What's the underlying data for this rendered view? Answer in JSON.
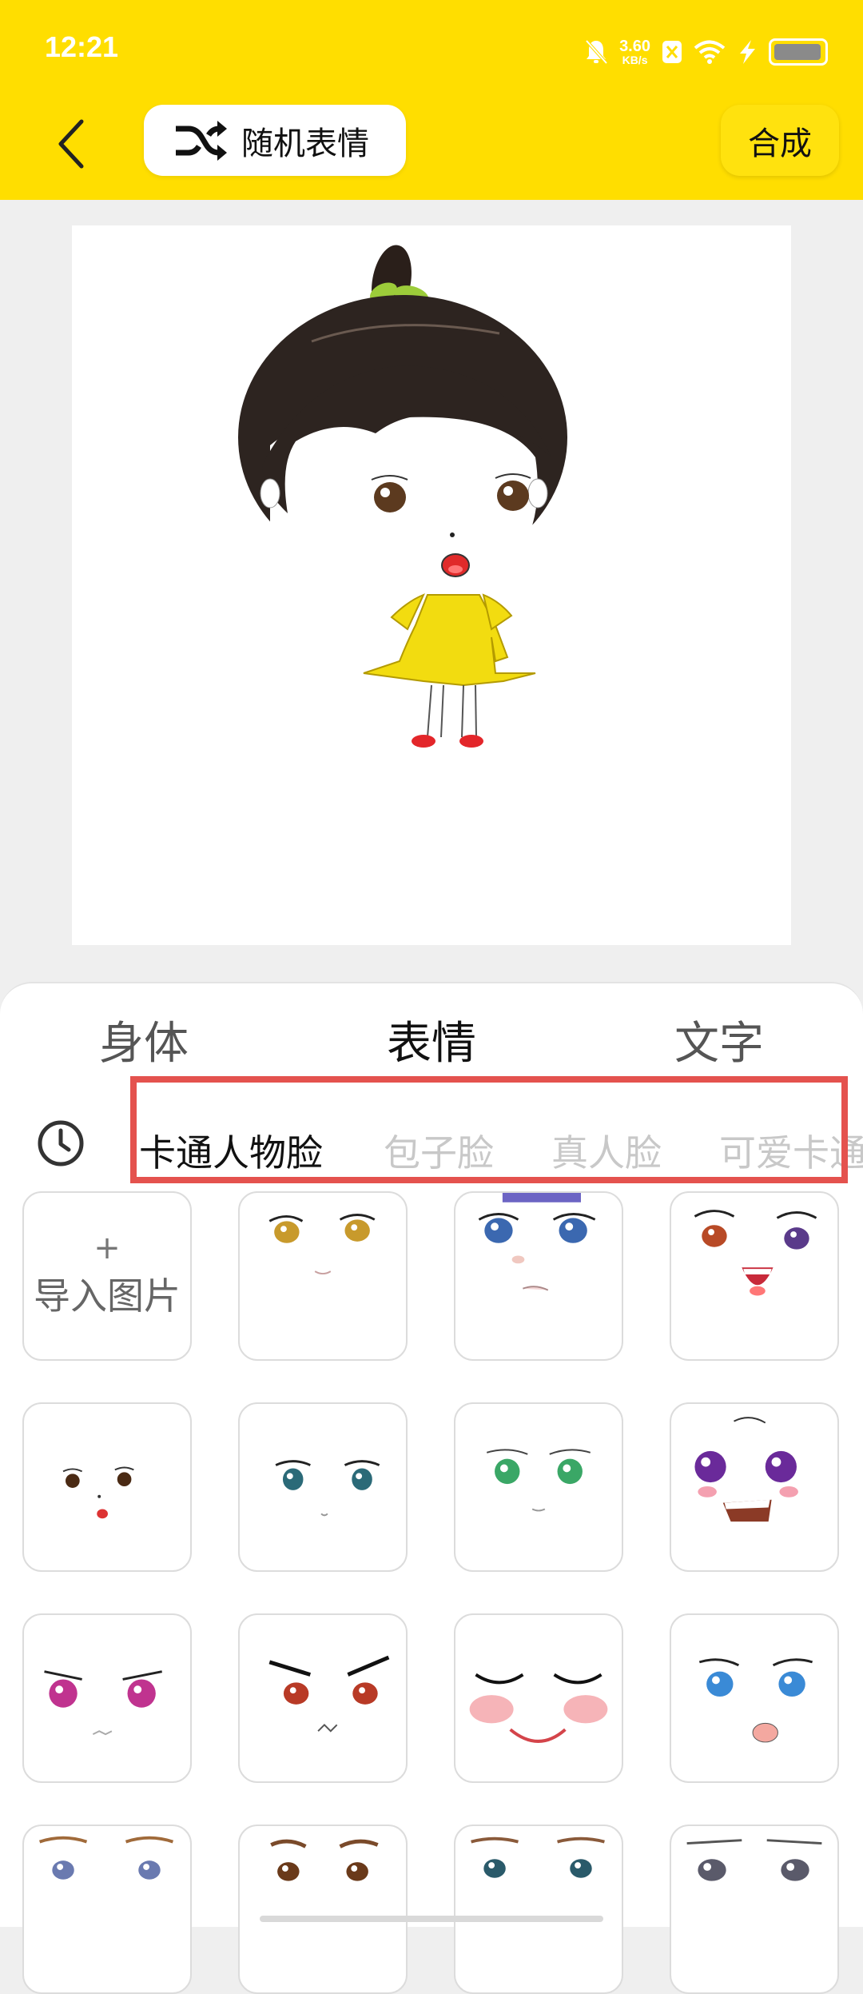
{
  "status_bar": {
    "time": "12:21",
    "net_speed_value": "3.60",
    "net_speed_unit": "KB/s",
    "icons": [
      "mute-icon",
      "vpn-icon",
      "wifi-icon",
      "charging-icon",
      "battery-icon"
    ]
  },
  "header": {
    "random_label": "随机表情",
    "compose_label": "合成"
  },
  "colors": {
    "header": "#FFDE00",
    "highlight": "#E4524E"
  },
  "tabs": [
    {
      "label": "身体",
      "active": false
    },
    {
      "label": "表情",
      "active": true
    },
    {
      "label": "文字",
      "active": false
    }
  ],
  "subtabs": [
    {
      "label": "卡通人物脸",
      "active": true
    },
    {
      "label": "包子脸",
      "active": false
    },
    {
      "label": "真人脸",
      "active": false
    },
    {
      "label": "可爱卡通",
      "active": false
    }
  ],
  "grid": {
    "import_plus": "+",
    "import_label": "导入图片",
    "faces": [
      "face-amber-eyes",
      "face-blue-eyes-crying",
      "face-laughing",
      "face-small-brown-eyes",
      "face-teal-eyes",
      "face-green-eyes",
      "face-purple-eyes-scared",
      "face-pink-eyes-angry",
      "face-red-eyes-angry",
      "face-closed-eyes-blush",
      "face-blue-eyes-sad",
      "face-blue-eyes-brows",
      "face-brown-eyes-brows",
      "face-teal-eyes-brows",
      "face-grey-eyes-brows"
    ]
  }
}
